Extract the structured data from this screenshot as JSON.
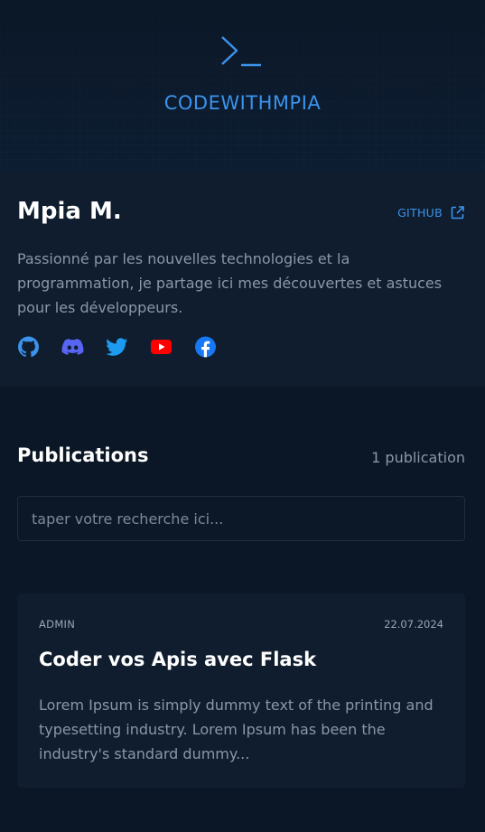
{
  "header": {
    "brand": "CODEWITHMPIA",
    "logo_icon": "terminal-icon",
    "accent_color": "#3b93ec"
  },
  "profile": {
    "name": "Mpia M.",
    "github_label": "GITHUB",
    "bio": "Passionné par les nouvelles technologies et la programmation, je partage ici mes découvertes et astuces pour les développeurs.",
    "socials": [
      {
        "name": "github-icon",
        "color": "#3b93ec"
      },
      {
        "name": "discord-icon",
        "color": "#5865f2"
      },
      {
        "name": "twitter-icon",
        "color": "#1d9bf0"
      },
      {
        "name": "youtube-icon",
        "color": "#ff0000"
      },
      {
        "name": "facebook-icon",
        "color": "#1877f2"
      }
    ]
  },
  "publications": {
    "title": "Publications",
    "count_label": "1 publication",
    "search_placeholder": "taper votre recherche ici...",
    "posts": [
      {
        "author": "ADMIN",
        "date": "22.07.2024",
        "title": "Coder vos Apis avec Flask",
        "excerpt": "Lorem Ipsum is simply dummy text of the printing and typesetting industry. Lorem Ipsum has been the industry's standard dummy..."
      }
    ]
  }
}
